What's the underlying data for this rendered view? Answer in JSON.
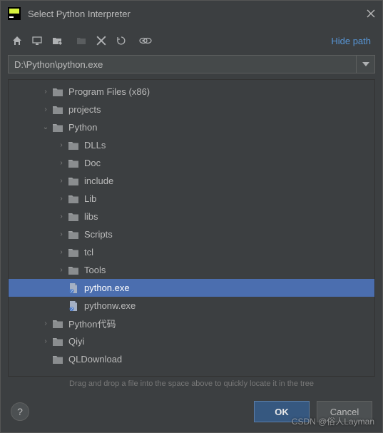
{
  "titlebar": {
    "title": "Select Python Interpreter"
  },
  "toolbar": {
    "hide_path": "Hide path"
  },
  "path": {
    "value": "D:\\Python\\python.exe"
  },
  "tree": [
    {
      "label": "Program Files (x86)",
      "depth": 2,
      "type": "folder",
      "arrow": "›",
      "selected": false
    },
    {
      "label": "projects",
      "depth": 2,
      "type": "folder",
      "arrow": "›",
      "selected": false
    },
    {
      "label": "Python",
      "depth": 2,
      "type": "folder",
      "arrow": "⌄",
      "selected": false
    },
    {
      "label": "DLLs",
      "depth": 3,
      "type": "folder",
      "arrow": "›",
      "selected": false
    },
    {
      "label": "Doc",
      "depth": 3,
      "type": "folder",
      "arrow": "›",
      "selected": false
    },
    {
      "label": "include",
      "depth": 3,
      "type": "folder",
      "arrow": "›",
      "selected": false
    },
    {
      "label": "Lib",
      "depth": 3,
      "type": "folder",
      "arrow": "›",
      "selected": false
    },
    {
      "label": "libs",
      "depth": 3,
      "type": "folder",
      "arrow": "›",
      "selected": false
    },
    {
      "label": "Scripts",
      "depth": 3,
      "type": "folder",
      "arrow": "›",
      "selected": false
    },
    {
      "label": "tcl",
      "depth": 3,
      "type": "folder",
      "arrow": "›",
      "selected": false
    },
    {
      "label": "Tools",
      "depth": 3,
      "type": "folder",
      "arrow": "›",
      "selected": false
    },
    {
      "label": "python.exe",
      "depth": 3,
      "type": "file",
      "arrow": "",
      "selected": true
    },
    {
      "label": "pythonw.exe",
      "depth": 3,
      "type": "file",
      "arrow": "",
      "selected": false
    },
    {
      "label": "Python代码",
      "depth": 2,
      "type": "folder",
      "arrow": "›",
      "selected": false
    },
    {
      "label": "Qiyi",
      "depth": 2,
      "type": "folder",
      "arrow": "›",
      "selected": false
    },
    {
      "label": "QLDownload",
      "depth": 2,
      "type": "folder",
      "arrow": "",
      "selected": false
    }
  ],
  "hint": "Drag and drop a file into the space above to quickly locate it in the tree",
  "buttons": {
    "ok": "OK",
    "cancel": "Cancel",
    "help": "?"
  },
  "watermark": "CSDN @俗人Layman"
}
